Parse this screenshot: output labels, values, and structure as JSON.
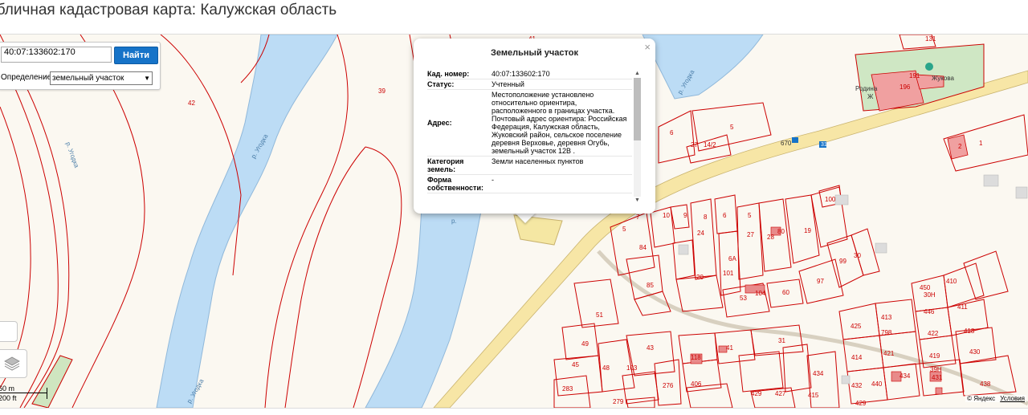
{
  "page": {
    "title": "убличная кадастровая карта: Калужская область"
  },
  "search": {
    "value": "40:07:133602:170",
    "button_label": "Найти",
    "definition_label": "Определение:",
    "definition_value": "земельный участок"
  },
  "scale": {
    "metric": "60 m",
    "imperial": "200 ft"
  },
  "copyright": {
    "text": "© Яндекс",
    "link": "Условия"
  },
  "popup": {
    "title": "Земельный участок",
    "close": "×",
    "rows": [
      {
        "key": "Кад. номер:",
        "value": "40:07:133602:170"
      },
      {
        "key": "Статус:",
        "value": "Учтенный"
      },
      {
        "key": "Адрес:",
        "value": "Местоположение установлено относительно ориентира, расположенного в границах участка. Почтовый адрес ориентира: Российская Федерация, Калужская область, Жуковский район, сельское поселение деревня Верховье, деревня Огубь, земельный участок 12В ."
      },
      {
        "key": "Категория земель:",
        "value": "Земли населенных пунктов"
      },
      {
        "key": "Форма собственности:",
        "value": "-"
      }
    ]
  },
  "map": {
    "water_labels": [
      "р. Угодка",
      "р. Угодка",
      "р. Угодка",
      "р. Угодка",
      "р."
    ],
    "place_labels": [
      "Родина",
      "Ж",
      "Жукова"
    ],
    "road_labels": [
      "670",
      "31"
    ],
    "parcel_numbers": [
      "42",
      "39",
      "41",
      "131",
      "191",
      "196",
      "6",
      "5",
      "27",
      "14/2",
      "2",
      "1",
      "100",
      "10",
      "9",
      "8",
      "6",
      "5",
      "7",
      "5",
      "24",
      "27",
      "28",
      "80",
      "19",
      "84",
      "20",
      "101",
      "6А",
      "99",
      "30",
      "97",
      "85",
      "53",
      "104",
      "60",
      "450",
      "30Н",
      "410",
      "446",
      "411",
      "51",
      "413",
      "422",
      "418",
      "49",
      "425",
      "798",
      "43",
      "118",
      "41",
      "31",
      "421",
      "419",
      "430",
      "45",
      "48",
      "103",
      "414",
      "39Н",
      "431",
      "283",
      "406",
      "434",
      "440",
      "432",
      "434",
      "438",
      "276",
      "429",
      "427",
      "415",
      "429",
      "279"
    ],
    "colors": {
      "water": "#bcdcf5",
      "parcel_border": "#cc0000",
      "road": "#f7e6a6",
      "selected": "#f5e7a3",
      "building": "#e88a8a"
    }
  }
}
